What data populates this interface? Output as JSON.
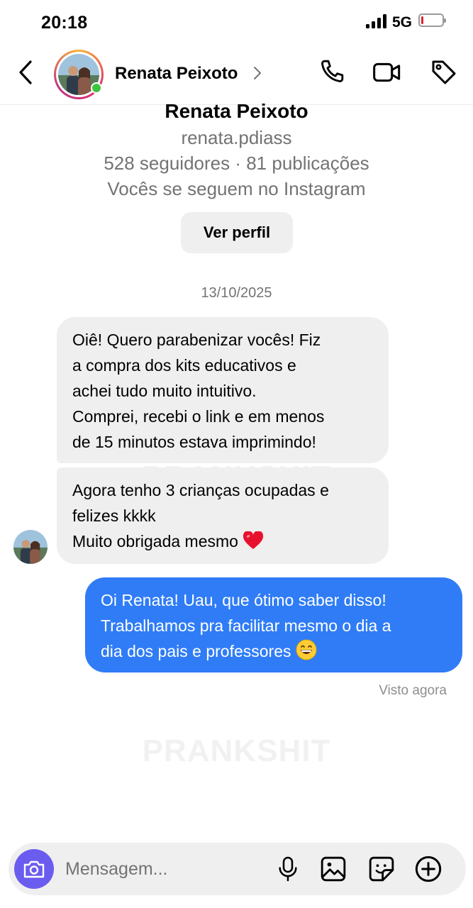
{
  "status_bar": {
    "time": "20:18",
    "network": "5G",
    "battery_level": 0.12,
    "battery_color": "#e0232b"
  },
  "header": {
    "contact_name": "Renata Peixoto",
    "icons": [
      "back-icon",
      "chevron-right-icon",
      "phone-icon",
      "video-icon",
      "tag-icon"
    ],
    "online": true
  },
  "profile": {
    "name": "Renata Peixoto",
    "username": "renata.pdiass",
    "stats": "528 seguidores · 81 publicações",
    "mutual": "Vocês se seguem no Instagram",
    "view_profile_label": "Ver perfil"
  },
  "conversation": {
    "date": "13/10/2025",
    "incoming": [
      {
        "lines": [
          "Oiê! Quero parabenizar vocês! Fiz",
          "a compra dos kits educativos e",
          "achei tudo muito intuitivo.",
          "Comprei, recebi o link e em menos",
          "de 15 minutos estava imprimindo!"
        ]
      },
      {
        "lines": [
          "Agora tenho 3 crianças ocupadas e",
          "felizes kkkk",
          "Muito obrigada mesmo"
        ],
        "emoji": "heart-emoji"
      }
    ],
    "outgoing": [
      {
        "lines": [
          "Oi Renata! Uau, que ótimo saber disso!",
          "Trabalhamos pra facilitar mesmo o dia a",
          "dia dos pais e professores"
        ],
        "emoji": "grinning-emoji"
      }
    ],
    "seen_status": "Visto agora",
    "watermark": "PRANKSHIT"
  },
  "composer": {
    "placeholder": "Mensagem...",
    "icons": [
      "camera-icon",
      "microphone-icon",
      "gallery-icon",
      "sticker-icon",
      "add-icon"
    ]
  },
  "colors": {
    "outgoing_bubble": "#2f7cf6",
    "incoming_bubble": "#efefef",
    "camera_button": "#6b5cf0",
    "online_dot": "#3ec33e"
  }
}
